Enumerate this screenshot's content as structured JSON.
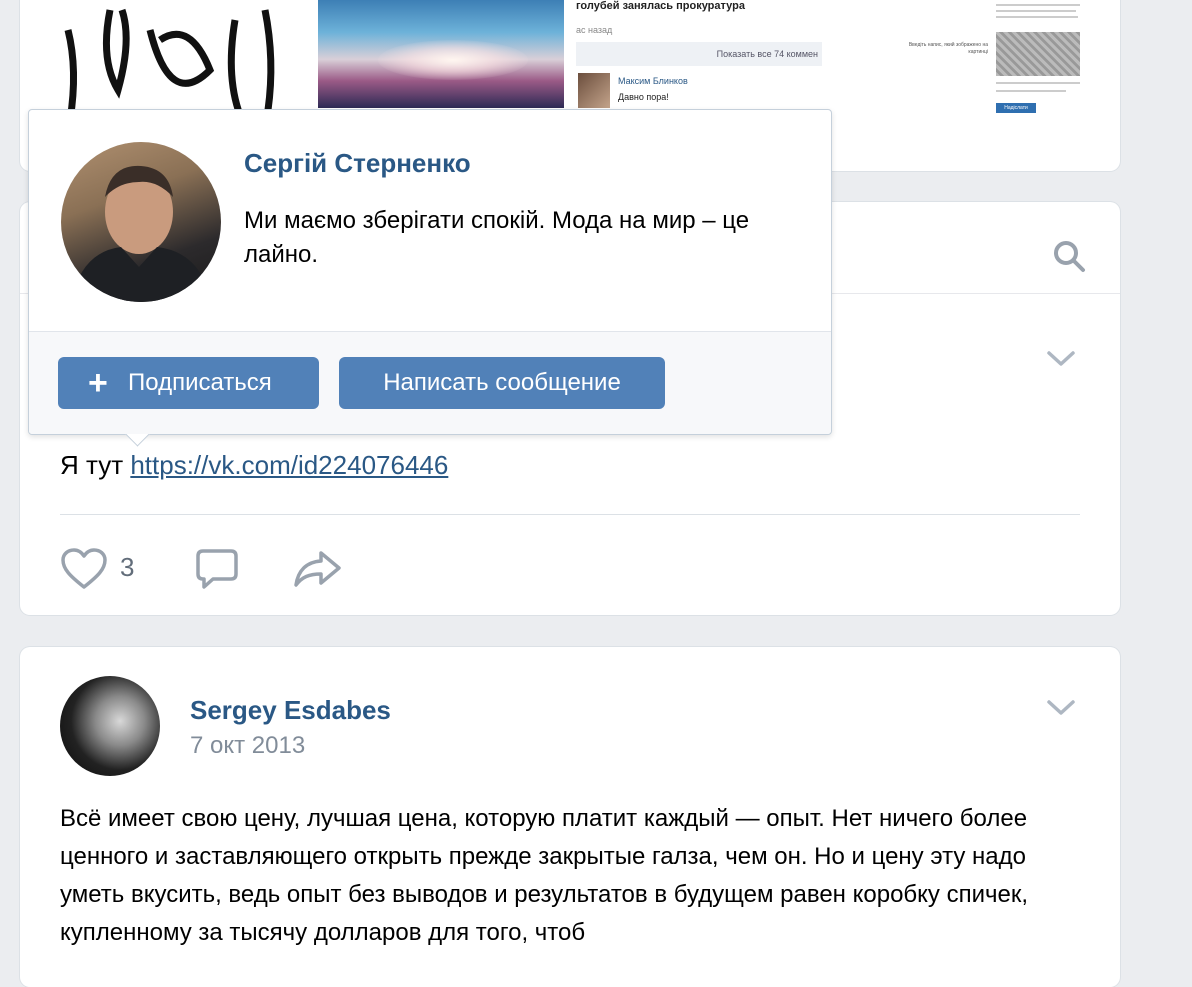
{
  "news_preview": {
    "title": "голубей занялась прокуратура",
    "time": "ас назад",
    "show_all": "Показать все 74 коммен",
    "comment_author": "Максим Блинков",
    "comment_text": "Давно пора!"
  },
  "form_preview": {
    "label": "Введіть напис, який зображено на картинці",
    "button": "Надіслати"
  },
  "profile_popup": {
    "name": "Сергій Стерненко",
    "status": "Ми маємо зберігати спокій. Мода на мир – це лайно.",
    "subscribe_label": "Подписаться",
    "subscribe_icon": "plus-icon",
    "message_label": "Написать сообщение"
  },
  "post1": {
    "text_prefix": "Я тут ",
    "link": "https://vk.com/id224076446",
    "likes": "3"
  },
  "post2": {
    "author": "Sergey Esdabes",
    "date": "7 окт 2013",
    "text": "Всё имеет свою цену, лучшая цена, которую платит каждый — опыт. Нет ничего более ценного и заставляющего открыть прежде закрытые галза, чем он. Но и цену эту надо уметь вкусить, ведь опыт без выводов и результатов в будущем равен коробку спичек, купленному за тысячу долларов для того, чтоб"
  },
  "colors": {
    "link": "#2a5885",
    "button": "#5181b8",
    "background": "#ebedf0"
  }
}
